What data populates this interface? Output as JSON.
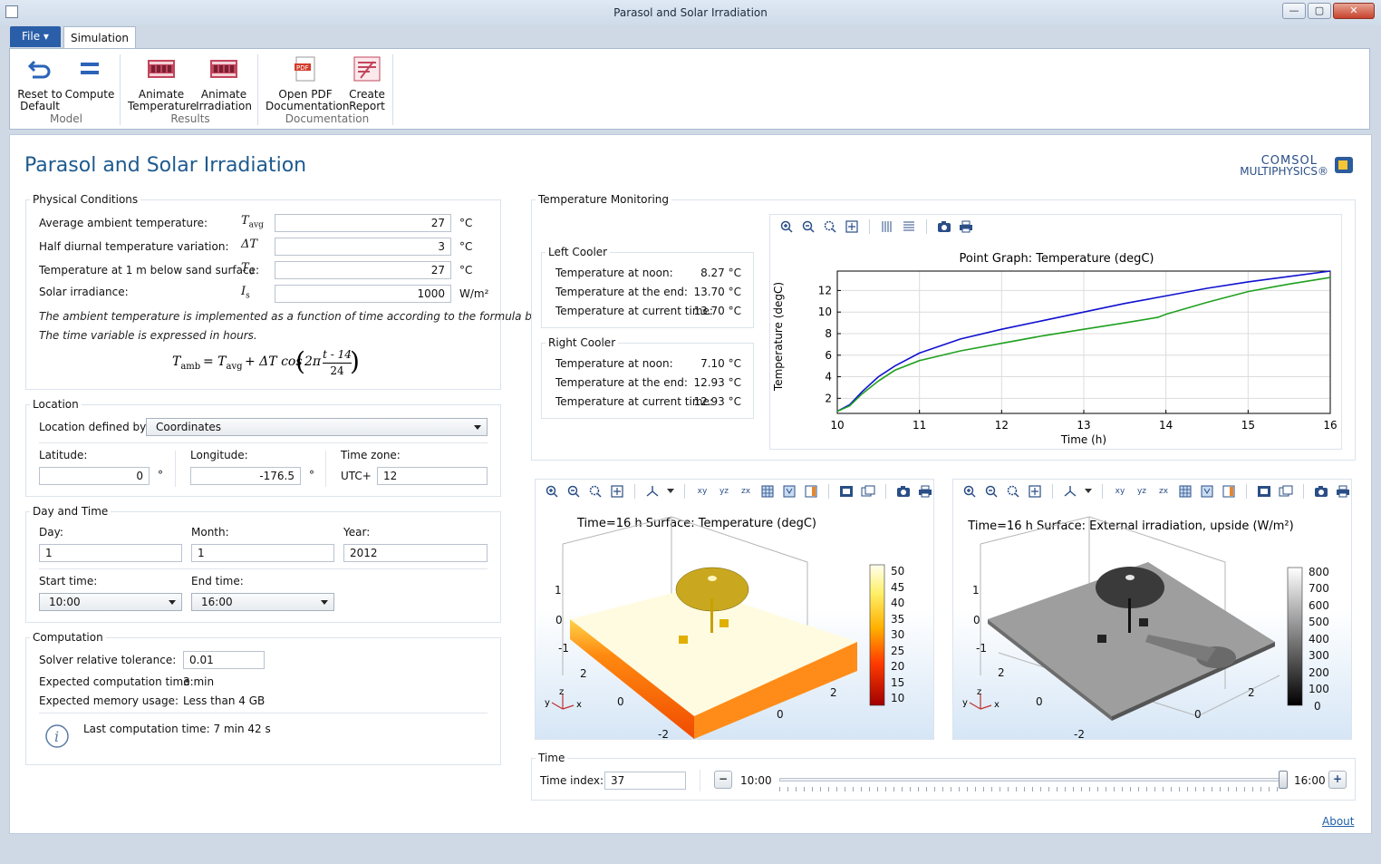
{
  "window": {
    "title": "Parasol and Solar Irradiation",
    "min": "—",
    "max": "▢",
    "close": "✕"
  },
  "tabs": {
    "file": "File ▾",
    "simulation": "Simulation"
  },
  "ribbon": {
    "reset": "Reset to Default",
    "compute": "Compute",
    "group_model": "Model",
    "animate_temp": "Animate Temperature",
    "animate_irr": "Animate Irradiation",
    "group_results": "Results",
    "open_pdf": "Open PDF Documentation",
    "create_report": "Create Report",
    "group_doc": "Documentation"
  },
  "page_title": "Parasol and Solar Irradiation",
  "logo": {
    "line1": "COMSOL",
    "line2": "MULTIPHYSICS®"
  },
  "physical": {
    "title": "Physical Conditions",
    "rows": [
      {
        "label": "Average ambient temperature:",
        "sym": "T",
        "sub": "avg",
        "value": "27",
        "unit": "°C"
      },
      {
        "label": "Half diurnal temperature variation:",
        "sym": "ΔT",
        "sub": "",
        "value": "3",
        "unit": "°C"
      },
      {
        "label": "Temperature at 1 m below sand surface:",
        "sym": "T",
        "sub": "0",
        "value": "27",
        "unit": "°C"
      },
      {
        "label": "Solar irradiance:",
        "sym": "I",
        "sub": "s",
        "value": "1000",
        "unit": "W/m²"
      }
    ],
    "note1": "The ambient temperature is implemented as a function of time according to the formula below.",
    "note2": "The time variable is expressed in hours.",
    "formula_lhs": "T",
    "formula_lhs_sub": "amb",
    "formula_rhs1": "= T",
    "formula_rhs1_sub": "avg",
    "formula_rhs2": "+ ΔT cos",
    "formula_two_pi": "2π",
    "formula_num": "t - 14",
    "formula_den": "24"
  },
  "location": {
    "title": "Location",
    "defined_by_label": "Location defined by:",
    "defined_by_value": "Coordinates",
    "lat_label": "Latitude:",
    "lat_value": "0",
    "lat_unit": "°",
    "lon_label": "Longitude:",
    "lon_value": "-176.5",
    "lon_unit": "°",
    "tz_label": "Time zone:",
    "tz_prefix": "UTC+",
    "tz_value": "12"
  },
  "daytime": {
    "title": "Day and Time",
    "day_label": "Day:",
    "day_value": "1",
    "month_label": "Month:",
    "month_value": "1",
    "year_label": "Year:",
    "year_value": "2012",
    "start_label": "Start time:",
    "start_value": "10:00",
    "end_label": "End time:",
    "end_value": "16:00"
  },
  "computation": {
    "title": "Computation",
    "tol_label": "Solver relative tolerance:",
    "tol_value": "0.01",
    "time_label": "Expected computation time:",
    "time_value": "3 min",
    "mem_label": "Expected memory usage:",
    "mem_value": "Less than 4 GB",
    "last_label": "Last computation time: 7 min 42 s"
  },
  "monitoring": {
    "title": "Temperature Monitoring",
    "left": {
      "title": "Left Cooler",
      "rows": [
        {
          "label": "Temperature at noon:",
          "value": "8.27 °C"
        },
        {
          "label": "Temperature at the end:",
          "value": "13.70 °C"
        },
        {
          "label": "Temperature at current time:",
          "value": "13.70 °C"
        }
      ]
    },
    "right": {
      "title": "Right Cooler",
      "rows": [
        {
          "label": "Temperature at noon:",
          "value": "7.10 °C"
        },
        {
          "label": "Temperature at the end:",
          "value": "12.93 °C"
        },
        {
          "label": "Temperature at current time:",
          "value": "12.93 °C"
        }
      ]
    }
  },
  "chart_data": {
    "type": "line",
    "title": "Point Graph: Temperature (degC)",
    "xlabel": "Time (h)",
    "ylabel": "Temperature (degC)",
    "xlim": [
      10,
      16
    ],
    "ylim": [
      0.6,
      13.8
    ],
    "xticks": [
      "10",
      "11",
      "12",
      "13",
      "14",
      "15",
      "16"
    ],
    "yticks": [
      "2",
      "4",
      "6",
      "8",
      "10",
      "12"
    ],
    "grid": true,
    "series": [
      {
        "color": "#1010d0",
        "x": [
          10,
          10.15,
          10.3,
          10.5,
          10.7,
          11,
          11.5,
          12,
          12.5,
          13,
          13.5,
          14,
          14.5,
          15,
          15.5,
          16
        ],
        "y": [
          0.8,
          1.4,
          2.6,
          4.0,
          5.0,
          6.2,
          7.5,
          8.4,
          9.2,
          10.0,
          10.8,
          11.5,
          12.2,
          12.8,
          13.3,
          13.8
        ]
      },
      {
        "color": "#20a020",
        "x": [
          10,
          10.15,
          10.3,
          10.5,
          10.7,
          11,
          11.5,
          12,
          12.5,
          13,
          13.5,
          13.9,
          14,
          14.5,
          15,
          15.5,
          16
        ],
        "y": [
          0.8,
          1.3,
          2.4,
          3.6,
          4.6,
          5.5,
          6.4,
          7.1,
          7.8,
          8.4,
          9.0,
          9.5,
          9.8,
          10.9,
          11.9,
          12.6,
          13.2
        ]
      }
    ]
  },
  "view_left": {
    "title": "Time=16 h   Surface: Temperature (degC)",
    "scale": [
      "50",
      "45",
      "40",
      "35",
      "30",
      "25",
      "20",
      "15",
      "10"
    ],
    "axis_labels": [
      "1",
      "0",
      "-1",
      "2",
      "0",
      "0",
      "2",
      "-2"
    ]
  },
  "view_right": {
    "title": "Time=16 h   Surface: External irradiation, upside (W/m²)",
    "scale": [
      "800",
      "700",
      "600",
      "500",
      "400",
      "300",
      "200",
      "100",
      "0"
    ],
    "axis_labels": [
      "1",
      "0",
      "-1",
      "2",
      "0",
      "0",
      "2",
      "-2"
    ]
  },
  "time": {
    "title": "Time",
    "index_label": "Time index:",
    "index_value": "37",
    "start": "10:00",
    "end": "16:00",
    "slider_fraction": 1.0
  },
  "about": "About"
}
